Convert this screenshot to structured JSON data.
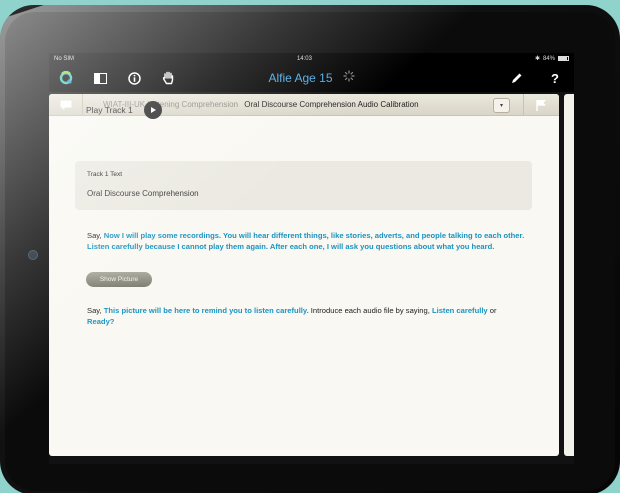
{
  "status_bar": {
    "carrier": "No SIM",
    "time": "14:03",
    "bluetooth": "✱",
    "battery": "84%",
    "battery_level": 0.84
  },
  "nav": {
    "title": "Alfie Age 15",
    "icons": [
      "q-logo-icon",
      "sidebar-icon",
      "info-icon",
      "hand-icon",
      "spinner-icon",
      "pencil-icon",
      "help-icon"
    ],
    "help_label": "?"
  },
  "panel": {
    "subtest": "WIAT-III-UK Listening Comprehension",
    "item_title": "Oral Discourse Comprehension Audio Calibration",
    "dropdown_glyph": "▾",
    "play_label": "Play Track 1",
    "track_box": {
      "title": "Track 1 Text",
      "text": "Oral Discourse Comprehension"
    },
    "instructions1": {
      "say": "Say, ",
      "quote": "Now I will play some recordings. You will hear different things, like stories, adverts, and people talking to each other. Listen carefully because I cannot play them again. After each one, I will ask you questions about what you heard."
    },
    "show_picture_label": "Show Picture",
    "instructions2": {
      "say": "Say, ",
      "quote1": "This picture will be here to remind you to listen carefully.",
      "middle": " Introduce each audio file by saying, ",
      "quote2": "Listen carefully",
      "or": " or ",
      "quote3": "Ready?"
    }
  },
  "colors": {
    "accent_blue": "#4aa9e4",
    "instruction_blue": "#1a93c3",
    "panel_bg": "#f9f8f2",
    "background": "#8fd3cc"
  }
}
